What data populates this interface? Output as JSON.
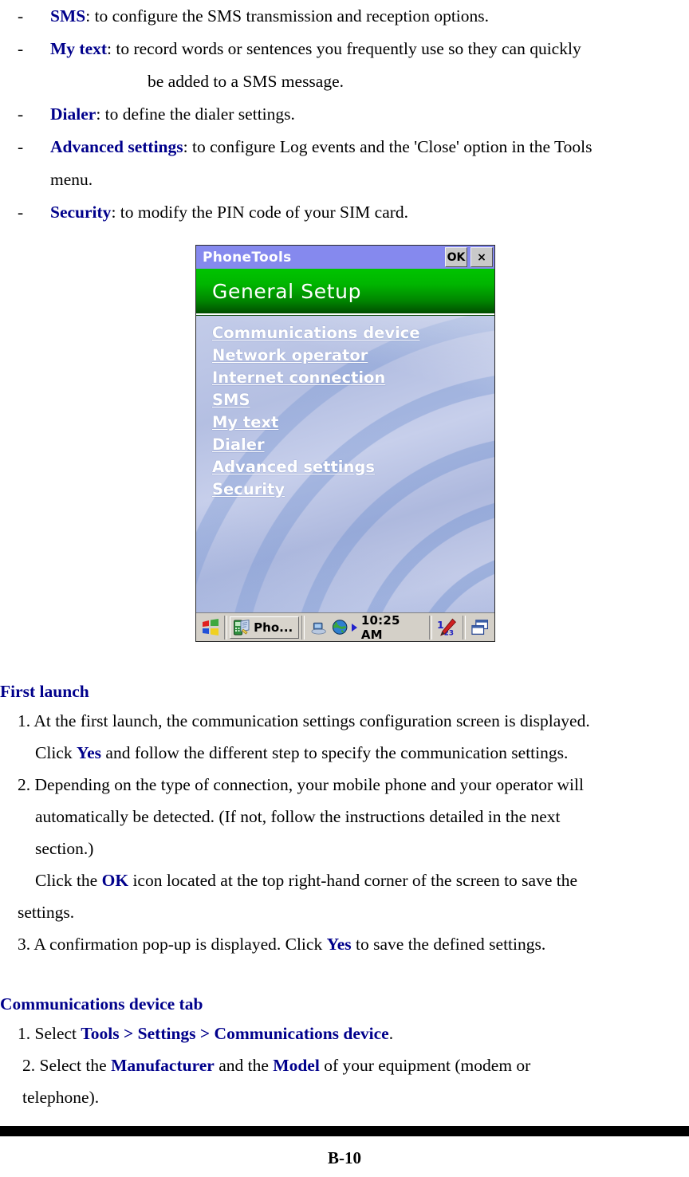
{
  "document": {
    "bullets": [
      {
        "marker": "-",
        "term": "SMS",
        "rest": ": to configure the SMS transmission and reception options."
      },
      {
        "marker": "-",
        "term": "My text",
        "rest": ": to record words or sentences you frequently use so they can quickly",
        "continuation": "be added to a SMS message."
      },
      {
        "marker": "-",
        "term": "Dialer",
        "rest": ": to define the dialer settings."
      },
      {
        "marker": "-",
        "term": "Advanced settings",
        "rest": ": to configure Log events and the 'Close' option in the Tools",
        "continuation": "menu."
      },
      {
        "marker": "-",
        "term": "Security",
        "rest": ": to modify the PIN code of your SIM card."
      }
    ],
    "first_launch": {
      "heading": "First launch",
      "steps": [
        {
          "number": "1.",
          "line1": "At the first launch, the communication settings configuration screen is displayed.",
          "line2_pre": "Click ",
          "line2_em": "Yes",
          "line2_post": " and follow the different step to specify the communication settings."
        },
        {
          "number": "2.",
          "line1": "Depending on the type of connection, your mobile phone and your operator will",
          "line2": "automatically be detected. (If not, follow the instructions detailed in the next",
          "line3": "section.)",
          "line4_pre": "Click the ",
          "line4_em": "OK",
          "line4_post": " icon located at the top right-hand corner of the screen to save the",
          "line5": "settings."
        },
        {
          "number": "3.",
          "line1_pre": "A confirmation pop-up is displayed. Click ",
          "line1_em": "Yes",
          "line1_post": " to save the defined settings."
        }
      ]
    },
    "comm_device_tab": {
      "heading": "Communications device tab",
      "steps": [
        {
          "number": "1.",
          "pre": "Select ",
          "em1": "Tools",
          "mid1": " > ",
          "em2": "Settings",
          "mid2": " > ",
          "em3": "Communications device",
          "post": "."
        },
        {
          "number": "2.",
          "pre": "Select the ",
          "em1": "Manufacturer",
          "mid1": " and the ",
          "em2": "Model",
          "post": " of your equipment (modem or",
          "line2": "telephone)."
        }
      ]
    },
    "footer": {
      "page_label": "B-10"
    }
  },
  "pda_screenshot": {
    "titlebar": {
      "title": "PhoneTools",
      "ok_button": "OK",
      "close_button": "×"
    },
    "header": {
      "title": "General Setup"
    },
    "menu_items": [
      "Communications device",
      "Network operator",
      "Internet connection",
      "SMS",
      "My text",
      "Dialer",
      "Advanced settings",
      "Security"
    ],
    "taskbar": {
      "start_icon": "windows-start-icon",
      "active_task_label": "Pho...",
      "active_task_icon": "phonetools-icon",
      "tray_icons": [
        "connectivity-icon",
        "globe-icon"
      ],
      "tray_arrow": "play-arrow-icon",
      "clock": "10:25 AM",
      "input_panel_icon": "stylus-keyboard-icon",
      "window_switch_icon": "windows-cascade-icon"
    },
    "colors": {
      "titlebar_bg": "#8589ee",
      "header_green_top": "#00c400",
      "header_green_bottom": "#004d00",
      "wallpaper_blue": "#b9c2e4",
      "taskbar_bg": "#d4d0c8",
      "doc_accent_blue": "#00008B"
    }
  }
}
